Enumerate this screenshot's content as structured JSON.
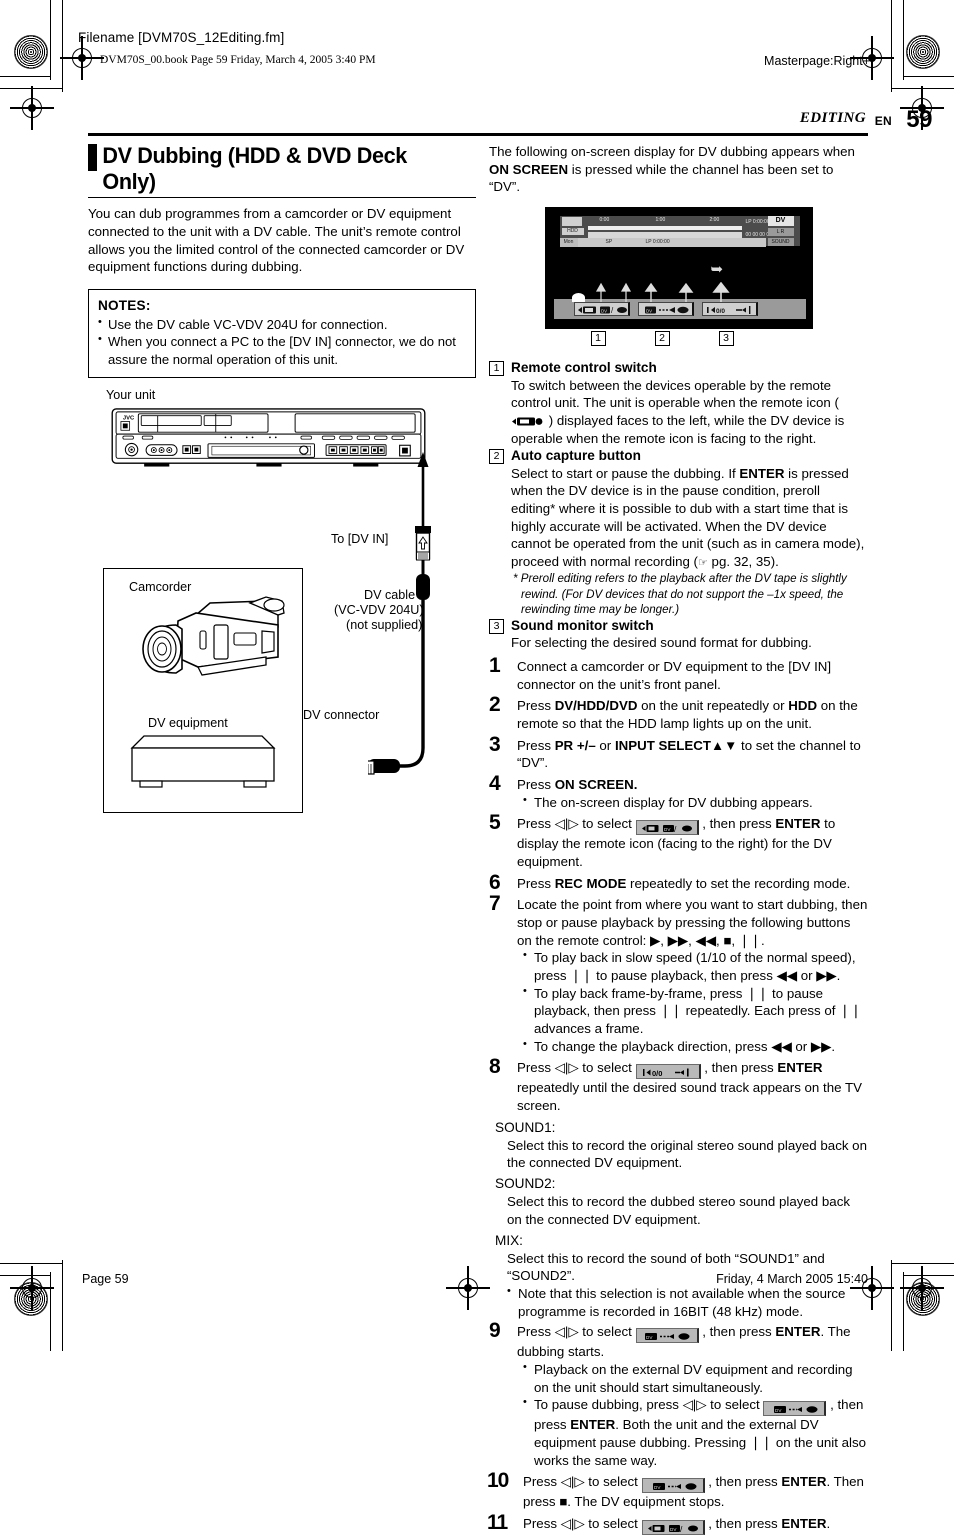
{
  "header": {
    "filename": "Filename [DVM70S_12Editing.fm]",
    "book_line": "DVM70S_00.book  Page 59  Friday, March 4, 2005  3:40 PM",
    "masterpage": "Masterpage:Right+",
    "chapter": "EDITING",
    "en_label": "EN",
    "page_number": "59"
  },
  "left": {
    "section_title": "DV Dubbing (HDD & DVD Deck Only)",
    "intro": "You can dub programmes from a camcorder or DV equipment connected to the unit with a DV cable. The unit’s remote control allows you the limited control of the connected camcorder or DV equipment functions during dubbing.",
    "notes": {
      "title": "NOTES:",
      "items": [
        "Use the DV cable VC-VDV 204U for connection.",
        "When you connect a PC to the [DV IN] connector, we do not assure the normal operation of this unit."
      ]
    },
    "diagram": {
      "your_unit": "Your unit",
      "brand": "JVC",
      "to_dv_in": "To [DV IN]",
      "camcorder": "Camcorder",
      "dv_cable_line1": "DV cable",
      "dv_cable_line2": "(VC-VDV 204U)",
      "dv_cable_line3": "(not supplied)",
      "dv_connector": "DV connector",
      "dv_equipment": "DV equipment"
    }
  },
  "right": {
    "intro_pre": "The following on-screen display for DV dubbing appears when ",
    "intro_bold": "ON SCREEN",
    "intro_post": " is pressed while the channel has been set to “DV”.",
    "osd": {
      "deck_label": "HDD",
      "time_ticks": [
        "0:00",
        "1:00",
        "2:00"
      ],
      "counter": "LP 0:00:00",
      "timecode": "00 00 00 00",
      "row3": [
        "DV",
        "SP",
        "LP 0:00:00"
      ],
      "mode_badge": "DV",
      "audio_badge": "L   R",
      "sound_badge": "SOUND",
      "left_badge": "HDD",
      "lbar_badge": "Mon"
    },
    "callouts": [
      "1",
      "2",
      "3"
    ],
    "items": [
      {
        "num": "1",
        "head": "Remote control switch",
        "body_pre": "To switch between the devices operable by the remote control unit. The unit is operable when the remote icon ( ",
        "body_post": " ) displayed faces to the left, while the DV device is operable when the remote icon is facing to the right."
      },
      {
        "num": "2",
        "head": "Auto capture button",
        "body_a": "Select to start or pause the dubbing. If ",
        "body_enter": "ENTER",
        "body_b": " is pressed when the DV device is in the pause condition, preroll editing* where it is possible to dub with a start time that is highly accurate will be activated. When the DV device cannot be operated from the unit (such as in camera mode), proceed with normal recording (",
        "body_c": " pg. 32, 35).",
        "footnote": "* Preroll editing refers to the playback after the DV tape is slightly rewind. (For DV devices that do not support the –1x speed, the rewinding time may be longer.)"
      },
      {
        "num": "3",
        "head": "Sound monitor switch",
        "body": "For selecting the desired sound format for dubbing."
      }
    ],
    "steps": [
      {
        "num": "1",
        "text": "Connect a camcorder or DV equipment to the [DV IN] connector on the unit’s front panel."
      },
      {
        "num": "2",
        "t1": "Press ",
        "b1": "DV/HDD/DVD",
        "t2": " on the unit repeatedly or ",
        "b2": "HDD",
        "t3": " on the remote so that the HDD lamp lights up on the unit."
      },
      {
        "num": "3",
        "t1": "Press ",
        "b1": "PR +/–",
        "t2": " or ",
        "b2": "INPUT SELECT▲▼",
        "t3": " to set the channel to “DV”."
      },
      {
        "num": "4",
        "t1": "Press ",
        "b1": "ON SCREEN.",
        "sub": [
          "The on-screen display for DV dubbing appears."
        ]
      },
      {
        "num": "5",
        "t1": "Press ◁|▷ to select ",
        "t2": " , then press ",
        "b1": "ENTER",
        "t3": " to display the remote icon (facing to the right) for the DV equipment."
      },
      {
        "num": "6",
        "t1": "Press ",
        "b1": "REC MODE",
        "t2": " repeatedly to set the recording mode."
      },
      {
        "num": "7",
        "text": "Locate the point from where you want to start dubbing, then stop or pause playback by pressing the following buttons on the remote control: ▶, ▶▶, ◀◀, ■, ❘❘.",
        "sub": [
          "To play back in slow speed (1/10 of the normal speed), press ❘❘ to pause playback, then press ◀◀ or ▶▶.",
          "To play back frame-by-frame, press ❘❘ to pause playback, then press ❘❘ repeatedly. Each press of ❘❘ advances a frame.",
          "To change the playback direction, press ◀◀ or ▶▶."
        ]
      },
      {
        "num": "8",
        "t1": "Press ◁|▷ to select ",
        "t2": " , then press ",
        "b1": "ENTER",
        "t3": " repeatedly until the desired sound track appears on the TV screen."
      }
    ],
    "sound_modes": [
      {
        "label": "SOUND1:",
        "desc": "Select this to record the original stereo sound played back on the connected DV equipment."
      },
      {
        "label": "SOUND2:",
        "desc": "Select this to record the dubbed stereo sound played back on the connected DV equipment."
      },
      {
        "label": "MIX:",
        "desc": "Select this to record the sound of both “SOUND1” and “SOUND2”.",
        "sub": "Note that this selection is not available when the source programme is recorded in 16BIT (48 kHz) mode."
      }
    ],
    "steps2": [
      {
        "num": "9",
        "t1": "Press ◁|▷ to select ",
        "t2": " , then press ",
        "b1": "ENTER",
        "t3": ". The dubbing starts.",
        "sub1": "Playback on the external DV equipment and recording on the unit should start simultaneously.",
        "sub2_a": "To pause dubbing, press ◁|▷ to select ",
        "sub2_b": " , then press ",
        "sub2_bold": "ENTER",
        "sub2_c": ". Both the unit and the external DV equipment pause dubbing. Pressing ❘❘ on the unit also works the same way."
      },
      {
        "num": "10",
        "t1": "Press ◁|▷ to select ",
        "t2": " , then press ",
        "b1": "ENTER",
        "t3": ". Then press ■. The DV equipment stops."
      },
      {
        "num": "11",
        "t1": "Press ◁|▷ to select ",
        "t2": " , then press ",
        "b1": "ENTER",
        "t3": "."
      }
    ]
  },
  "footer": {
    "page": "Page 59",
    "date": "Friday, 4 March 2005  15:40"
  },
  "colors": {
    "ink": "#000000",
    "paper": "#ffffff",
    "osd_chip": "#b9b9b9",
    "osd_bar": "#8c8c8c"
  }
}
